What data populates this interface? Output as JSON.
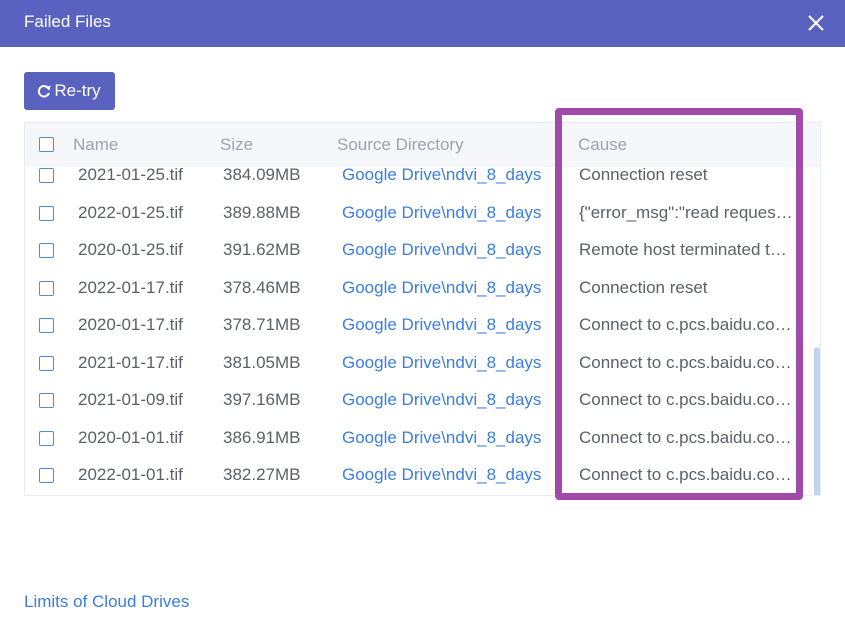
{
  "dialog": {
    "title": "Failed Files",
    "retry_label": "Re-try",
    "footer_link": "Limits of Cloud Drives"
  },
  "table": {
    "columns": {
      "name": "Name",
      "size": "Size",
      "source": "Source Directory",
      "cause": "Cause"
    },
    "rows": [
      {
        "name": "2021-01-25.tif",
        "size": "384.09MB",
        "source": "Google Drive\\ndvi_8_days",
        "cause": "Connection reset"
      },
      {
        "name": "2022-01-25.tif",
        "size": "389.88MB",
        "source": "Google Drive\\ndvi_8_days",
        "cause": "{\"error_msg\":\"read request timeout\"}"
      },
      {
        "name": "2020-01-25.tif",
        "size": "391.62MB",
        "source": "Google Drive\\ndvi_8_days",
        "cause": "Remote host terminated the handshake"
      },
      {
        "name": "2022-01-17.tif",
        "size": "378.46MB",
        "source": "Google Drive\\ndvi_8_days",
        "cause": "Connection reset"
      },
      {
        "name": "2020-01-17.tif",
        "size": "378.71MB",
        "source": "Google Drive\\ndvi_8_days",
        "cause": "Connect to c.pcs.baidu.com failed"
      },
      {
        "name": "2021-01-17.tif",
        "size": "381.05MB",
        "source": "Google Drive\\ndvi_8_days",
        "cause": "Connect to c.pcs.baidu.com failed"
      },
      {
        "name": "2021-01-09.tif",
        "size": "397.16MB",
        "source": "Google Drive\\ndvi_8_days",
        "cause": "Connect to c.pcs.baidu.com failed"
      },
      {
        "name": "2020-01-01.tif",
        "size": "386.91MB",
        "source": "Google Drive\\ndvi_8_days",
        "cause": "Connect to c.pcs.baidu.com failed"
      },
      {
        "name": "2022-01-01.tif",
        "size": "382.27MB",
        "source": "Google Drive\\ndvi_8_days",
        "cause": "Connect to c.pcs.baidu.com failed"
      }
    ]
  },
  "icons": {
    "close": "close-icon",
    "retry": "refresh-icon",
    "checkbox": "checkbox-icon"
  },
  "colors": {
    "titlebar": "#5a62c0",
    "link": "#3b7ee0",
    "highlight": "#a04aab"
  }
}
